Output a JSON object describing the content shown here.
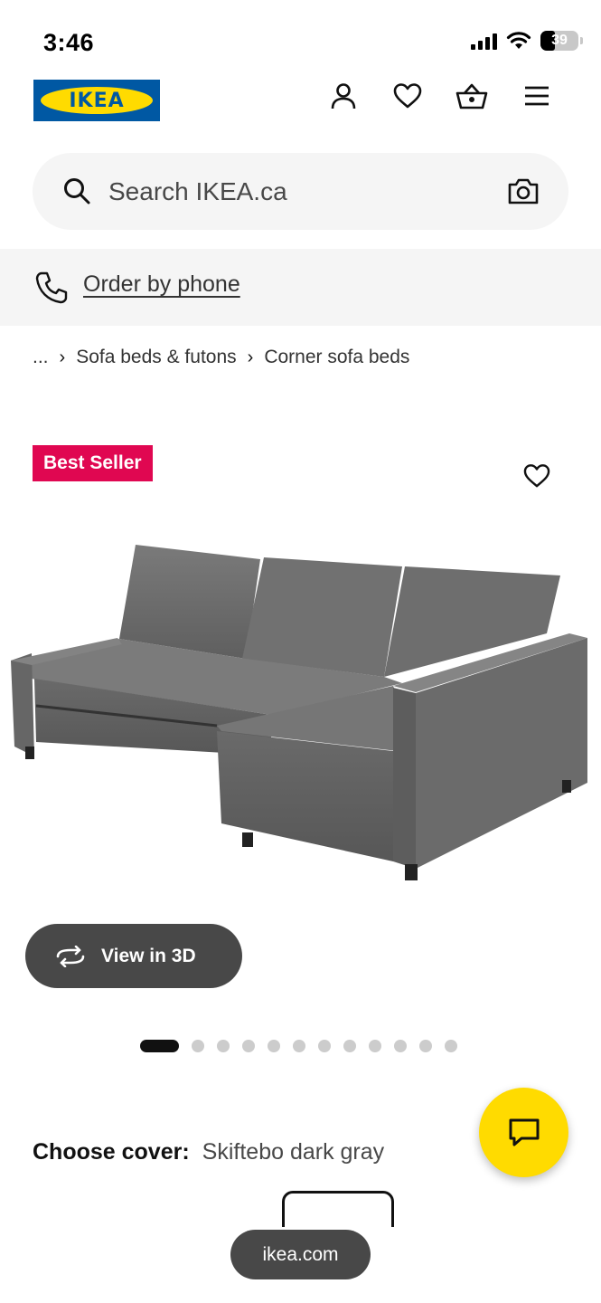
{
  "status_bar": {
    "time": "3:46",
    "battery": "39",
    "battery_level": 0.39,
    "icons": [
      "cellular-signal-icon",
      "wifi-icon",
      "battery-icon"
    ]
  },
  "header": {
    "logo_text": "IKEA",
    "brand_colors": {
      "blue": "#0058a3",
      "yellow": "#ffdb00"
    },
    "icons": [
      "person-icon",
      "heart-icon",
      "shopping-basket-icon",
      "menu-icon"
    ]
  },
  "search": {
    "placeholder": "Search IKEA.ca",
    "icons": [
      "search-icon",
      "camera-icon"
    ]
  },
  "phone_banner": {
    "link_text": "Order by phone",
    "icon": "phone-icon"
  },
  "breadcrumb": {
    "items": [
      "...",
      "Sofa beds & futons",
      "Corner sofa beds"
    ],
    "separator": "›"
  },
  "product": {
    "badge": "Best Seller",
    "badge_color": "#e00751",
    "view_3d_label": "View in 3D",
    "image_count": 12,
    "active_image": 1,
    "cover_label": "Choose cover:",
    "cover_value": "Skiftebo dark gray"
  },
  "floating": {
    "chat_icon": "chat-bubble-icon",
    "chat_color": "#ffdb00"
  },
  "browser": {
    "url": "ikea.com"
  }
}
